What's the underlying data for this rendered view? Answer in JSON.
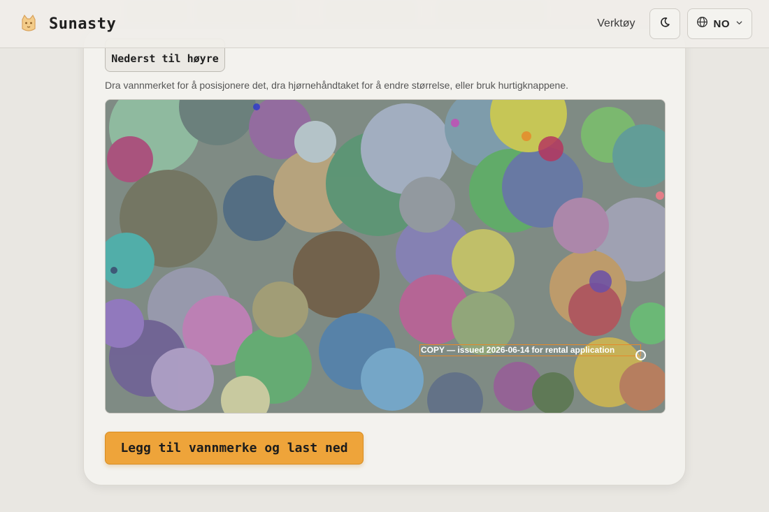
{
  "header": {
    "brand": "Sunasty",
    "tools_label": "Verktøy",
    "theme_toggle_icon": "moon-icon",
    "language": {
      "current": "NO",
      "icon": "globe-icon",
      "chevron": "chevron-down-icon"
    }
  },
  "watermark_panel": {
    "position_button_label": "Nederst til høyre",
    "help_text": "Dra vannmerket for å posisjonere det, dra hjørnehåndtaket for å endre størrelse, eller bruk hurtigknappene.",
    "watermark_text": "COPY — issued 2026-06-14 for rental application",
    "submit_label": "Legg til vannmerke og last ned"
  },
  "colors": {
    "accent": "#eea43a",
    "watermark_border": "#e5892a",
    "background": "#e9e7e2",
    "card": "#f3f2ee"
  }
}
